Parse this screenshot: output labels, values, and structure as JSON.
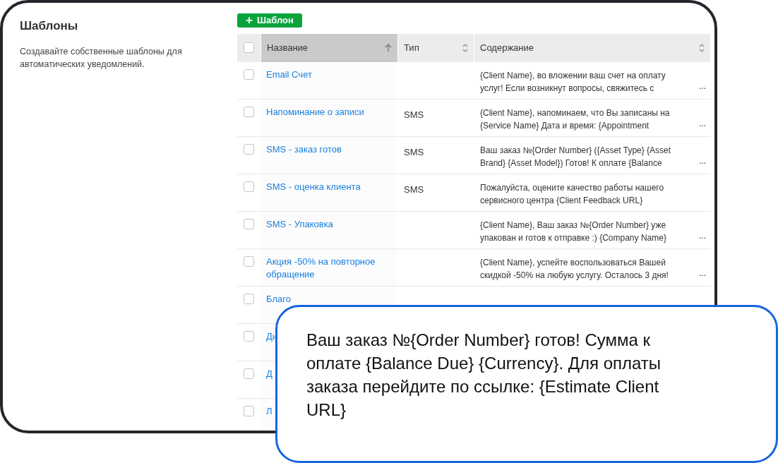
{
  "sidebar": {
    "title": "Шаблоны",
    "description": "Создавайте собственные шаблоны для автоматических уведомлений."
  },
  "add_button": {
    "icon": "+",
    "label": "Шаблон"
  },
  "table": {
    "columns": [
      {
        "label": "Название",
        "sorted": true,
        "selected": true
      },
      {
        "label": "Тип",
        "sorted": false,
        "selected": false
      },
      {
        "label": "Содержание",
        "sorted": false,
        "selected": false
      }
    ],
    "all_checked": false,
    "rows": [
      {
        "checked": false,
        "name": "Email Счет",
        "type": "",
        "content": [
          "{Client Name}, во вложении ваш счет на оплату",
          "услуг!   Если возникнут вопросы, свяжитесь с"
        ],
        "more": "..."
      },
      {
        "checked": false,
        "name": "Напоминание о записи",
        "type": "SMS",
        "content": [
          "{Client Name}, напоминаем, что Вы записаны на",
          "{Service Name} Дата и время: {Appointment"
        ],
        "more": "..."
      },
      {
        "checked": false,
        "name": "SMS - заказ готов",
        "type": "SMS",
        "content": [
          "Ваш заказ №{Order Number} ({Asset Type} {Asset",
          "Brand} {Asset Model}) Готов! К оплате {Balance"
        ],
        "more": "..."
      },
      {
        "checked": false,
        "name": "SMS - оценка клиента",
        "type": "SMS",
        "content": [
          "Пожалуйста, оцените качество работы нашего",
          "сервисного центра {Client Feedback URL}"
        ]
      },
      {
        "checked": false,
        "name": "SMS - Упаковка",
        "type": "",
        "content": [
          "{Client Name}, Ваш заказ №{Order Number} уже",
          "упакован и готов к отправке :) {Company Name}"
        ],
        "more": "..."
      },
      {
        "checked": false,
        "name": "Акция -50% на повторное обращение",
        "type": "",
        "content": [
          "{Client Name}, успейте воспользоваться Вашей",
          "скидкой -50% на любую услугу. Осталось 3 дня!"
        ],
        "more": "..."
      },
      {
        "checked": false,
        "name": "Благо"
      },
      {
        "checked": false,
        "name": "Ди"
      },
      {
        "checked": false,
        "name": "Д"
      },
      {
        "checked": false,
        "name": "Л"
      }
    ]
  },
  "callout": {
    "text": "Ваш заказ №{Order Number} готов! Сумма к оплате {Balance Due} {Currency}. Для оплаты заказа перейдите по ссылке: {Estimate Client URL}"
  }
}
